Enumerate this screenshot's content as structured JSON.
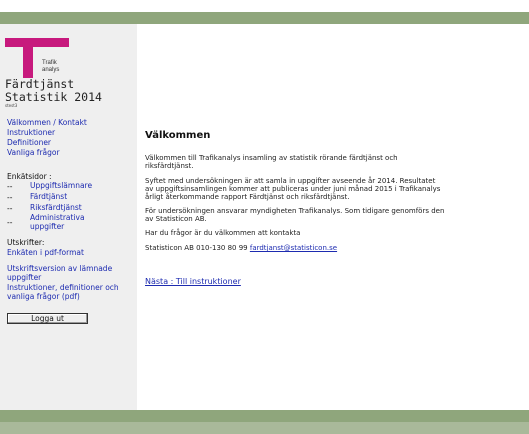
{
  "logo": {
    "line1": "Trafik",
    "line2": "analys"
  },
  "app": {
    "title_line1": "Färdtjänst",
    "title_line2": "Statistik 2014",
    "subtitle": "stest3"
  },
  "nav": {
    "welcome": "Välkommen / Kontakt",
    "instructions": "Instruktioner",
    "definitions": "Definitioner",
    "faq": "Vanliga frågor"
  },
  "survey_pages": {
    "label": "Enkätsidor :",
    "items": [
      {
        "dash": "--",
        "label": "Uppgiftslämnare"
      },
      {
        "dash": "--",
        "label": "Färdtjänst"
      },
      {
        "dash": "--",
        "label": "Riksfärdtjänst"
      },
      {
        "dash": "--",
        "label": "Administrativa uppgifter"
      }
    ]
  },
  "printouts": {
    "label": "Utskrifter:",
    "pdf_survey": "Enkäten i pdf-format",
    "print_version": "Utskriftsversion av lämnade uppgifter",
    "instructions_pdf": "Instruktioner, definitioner och vanliga frågor (pdf)"
  },
  "logout_label": "Logga ut",
  "main": {
    "heading": "Välkommen",
    "p1": "Välkommen till Trafikanalys insamling av statistik rörande färdtjänst och riksfärdtjänst.",
    "p2": "Syftet med undersökningen är att samla in uppgifter avseende år 2014. Resultatet av uppgiftsinsamlingen kommer att publiceras under juni månad 2015 i Trafikanalys årligt återkommande rapport Färdtjänst och riksfärdtjänst.",
    "p3": "För undersökningen ansvarar myndigheten Trafikanalys. Som tidigare genomförs den av Statisticon AB.",
    "p4": "Har du frågor är du välkommen att kontakta",
    "contact_prefix": "Statisticon AB 010-130 80 99",
    "contact_email": "fardtjanst@statisticon.se",
    "next_link": "Nästa : Till instruktioner"
  },
  "colors": {
    "band_green": "#8fa67c",
    "brand_magenta": "#c7197d",
    "link_blue": "#1d2bb0",
    "sidebar_bg": "#efefef"
  }
}
